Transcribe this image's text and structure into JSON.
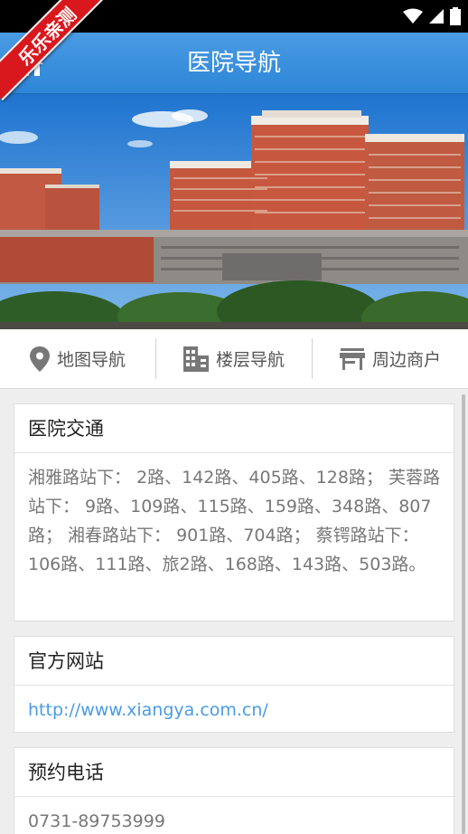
{
  "ribbon": {
    "text": "乐乐亲测"
  },
  "appbar": {
    "title": "医院导航"
  },
  "nav": [
    {
      "label": "地图导航",
      "icon": "map-pin-icon"
    },
    {
      "label": "楼层导航",
      "icon": "building-icon"
    },
    {
      "label": "周边商户",
      "icon": "store-icon"
    }
  ],
  "cards": {
    "transport": {
      "title": "医院交通",
      "body": "湘雅路站下： 2路、142路、405路、128路； 芙蓉路站下： 9路、109路、115路、159路、348路、807路； 湘春路站下： 901路、704路； 蔡锷路站下： 106路、111路、旅2路、168路、143路、503路。"
    },
    "website": {
      "title": "官方网站",
      "url": "http://www.xiangya.com.cn/"
    },
    "phone": {
      "title": "预约电话",
      "number": "0731-89753999"
    }
  },
  "colors": {
    "appbar": "#2d86d7",
    "link": "#4a9be3",
    "ribbon": "#d9181e"
  }
}
